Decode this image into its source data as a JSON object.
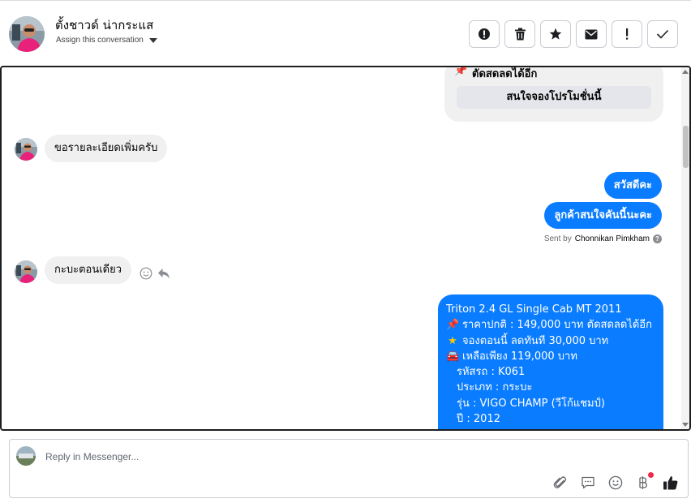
{
  "header": {
    "contact_name": "ตั้งชาวด์ น่ากระแส",
    "assign_label": "Assign this conversation",
    "actions": [
      {
        "name": "mark-spam-button",
        "icon": "alert-circle-icon"
      },
      {
        "name": "delete-button",
        "icon": "trash-icon"
      },
      {
        "name": "star-button",
        "icon": "star-icon"
      },
      {
        "name": "mark-unread-button",
        "icon": "envelope-icon"
      },
      {
        "name": "follow-up-button",
        "icon": "exclamation-icon"
      },
      {
        "name": "mark-done-button",
        "icon": "check-icon"
      }
    ]
  },
  "conversation": {
    "card": {
      "pin_text": "ตัดสดลดได้อีก",
      "button_label": "สนใจจองโปรโมชั่นนี้"
    },
    "msg_in_1": "ขอรายละเอียดเพิ่มครับ",
    "msg_out_1": "สวัสดีคะ",
    "msg_out_2": "ลูกค้าสนใจคันนี้นะคะ",
    "sent_by_prefix": "Sent by",
    "sent_by_name": "Chonnikan Pimkham",
    "msg_in_2": "กะบะตอนเดียว",
    "promo": {
      "title": "Triton 2.4 GL Single Cab MT 2011",
      "price_line": "ราคาปกติ : 149,000 บาท ตัดสดลดได้อีก",
      "discount_line": "จองตอนนี้ ลดทันที 30,000 บาท",
      "remaining_line": "เหลือเพียง 119,000 บาท",
      "code": "รหัสรถ : K061",
      "type": "ประเภท : กระบะ",
      "model": "รุ่น : VIGO CHAMP (วีโก้แชมป์)",
      "year": "ปี : 2012"
    }
  },
  "composer": {
    "placeholder": "Reply in Messenger..."
  },
  "colors": {
    "accent": "#0a7cff",
    "incoming_bubble": "#f0f0f0",
    "notification_dot": "#f02849"
  }
}
